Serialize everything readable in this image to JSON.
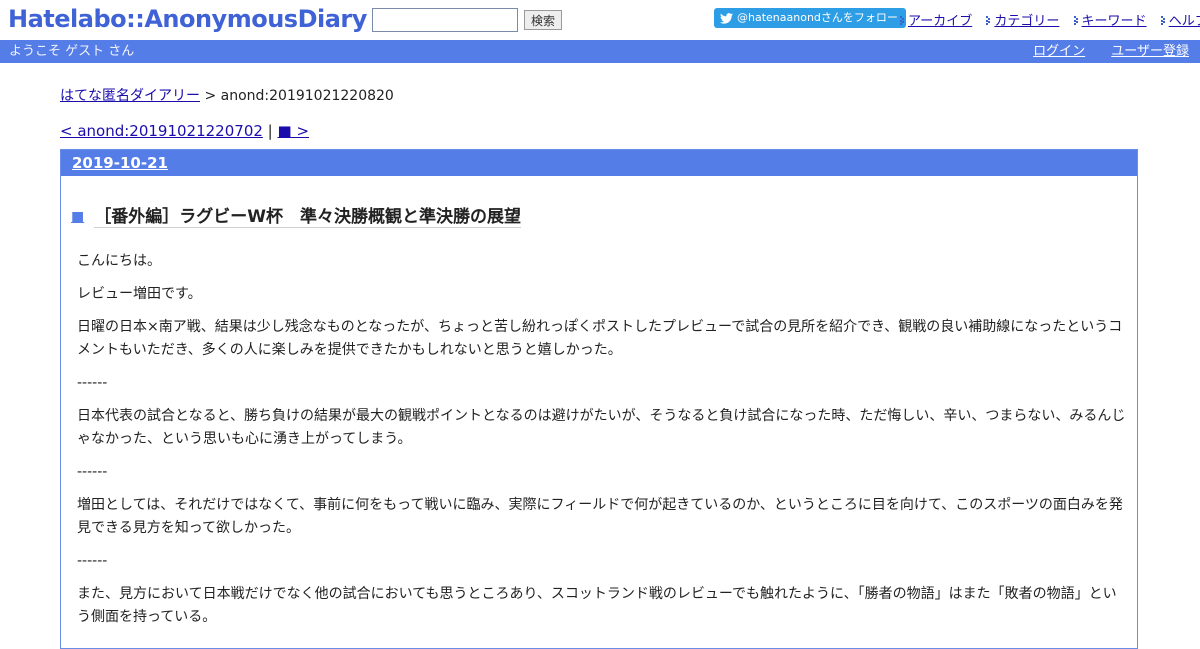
{
  "header": {
    "logo": "Hatelabo::AnonymousDiary",
    "search_placeholder": "",
    "search_button": "検索",
    "follow": "@hatenaanondさんをフォロー",
    "nav": [
      "アーカイブ",
      "カテゴリー",
      "キーワード",
      "ヘルプ"
    ]
  },
  "bar": {
    "welcome": "ようこそ ゲスト さん",
    "login": "ログイン",
    "register": "ユーザー登録"
  },
  "breadcrumb": {
    "home": "はてな匿名ダイアリー",
    "sep": " > ",
    "current": "anond:20191021220820"
  },
  "pager": {
    "prev": "< anond:20191021220702",
    "sep": " | ",
    "next": "■ >"
  },
  "entry": {
    "date": "2019-10-21",
    "title_mark": "■",
    "title": "［番外編］ラグビーW杯　準々決勝概観と準決勝の展望",
    "paragraphs": [
      "こんにちは。",
      "レビュー増田です。",
      "日曜の日本×南ア戦、結果は少し残念なものとなったが、ちょっと苦し紛れっぽくポストしたプレビューで試合の見所を紹介でき、観戦の良い補助線になったというコメントもいただき、多くの人に楽しみを提供できたかもしれないと思うと嬉しかった。",
      "------",
      "日本代表の試合となると、勝ち負けの結果が最大の観戦ポイントとなるのは避けがたいが、そうなると負け試合になった時、ただ悔しい、辛い、つまらない、みるんじゃなかった、という思いも心に湧き上がってしまう。",
      "------",
      "増田としては、それだけではなくて、事前に何をもって戦いに臨み、実際にフィールドで何が起きているのか、というところに目を向けて、このスポーツの面白みを発見できる見方を知って欲しかった。",
      "------",
      "また、見方において日本戦だけでなく他の試合においても思うところあり、スコットランド戦のレビューでも触れたように、「勝者の物語」はまた「敗者の物語」という側面を持っている。"
    ]
  }
}
